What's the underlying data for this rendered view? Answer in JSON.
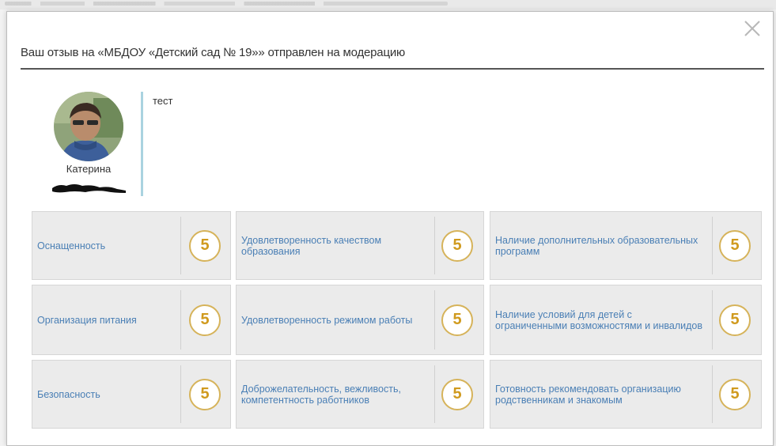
{
  "header": {
    "title": "Ваш отзыв на «МБДОУ «Детский сад № 19»» отправлен на модерацию"
  },
  "reviewer": {
    "name": "Катерина",
    "avatar": "user-photo"
  },
  "review": {
    "text": "тест"
  },
  "ratings": [
    {
      "label": "Оснащенность",
      "score": "5"
    },
    {
      "label": "Удовлетворенность качеством образования",
      "score": "5"
    },
    {
      "label": "Наличие дополнительных образовательных программ",
      "score": "5"
    },
    {
      "label": "Организация питания",
      "score": "5"
    },
    {
      "label": "Удовлетворенность режимом работы",
      "score": "5"
    },
    {
      "label": "Наличие условий для детей с ограниченными возможностями и инвалидов",
      "score": "5"
    },
    {
      "label": "Безопасность",
      "score": "5"
    },
    {
      "label": "Доброжелательность, вежливость, компетентность работников",
      "score": "5"
    },
    {
      "label": "Готовность рекомендовать организацию родственникам и знакомым",
      "score": "5"
    }
  ],
  "icons": {
    "close": "close-icon",
    "avatar": "avatar"
  },
  "colors": {
    "label_text": "#4a7fb5",
    "score_text": "#d09a1e",
    "score_border": "#d6b35a",
    "card_bg": "#ebebeb",
    "divider_accent": "#aad3e0"
  }
}
